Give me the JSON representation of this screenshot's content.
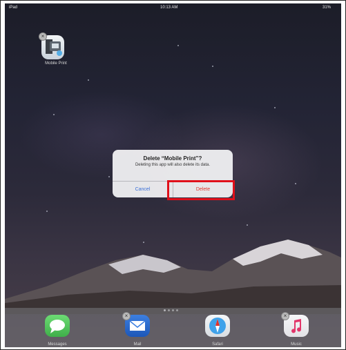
{
  "statusbar": {
    "carrier": "iPad",
    "time": "10:13 AM",
    "battery": "31%"
  },
  "home": {
    "app": {
      "label": "Mobile Print",
      "icon": "printer-icon"
    }
  },
  "dialog": {
    "title": "Delete “Mobile Print”?",
    "message": "Deleting this app will also delete its data.",
    "cancel_label": "Cancel",
    "delete_label": "Delete"
  },
  "page_indicator": {
    "pages": 4,
    "current": 1
  },
  "dock": [
    {
      "label": "Messages",
      "icon": "messages-icon"
    },
    {
      "label": "Mail",
      "icon": "mail-icon"
    },
    {
      "label": "Safari",
      "icon": "safari-icon"
    },
    {
      "label": "Music",
      "icon": "music-icon"
    }
  ],
  "colors": {
    "highlight": "#e0101a",
    "cancel": "#3a6fd8",
    "delete": "#e0342c"
  }
}
